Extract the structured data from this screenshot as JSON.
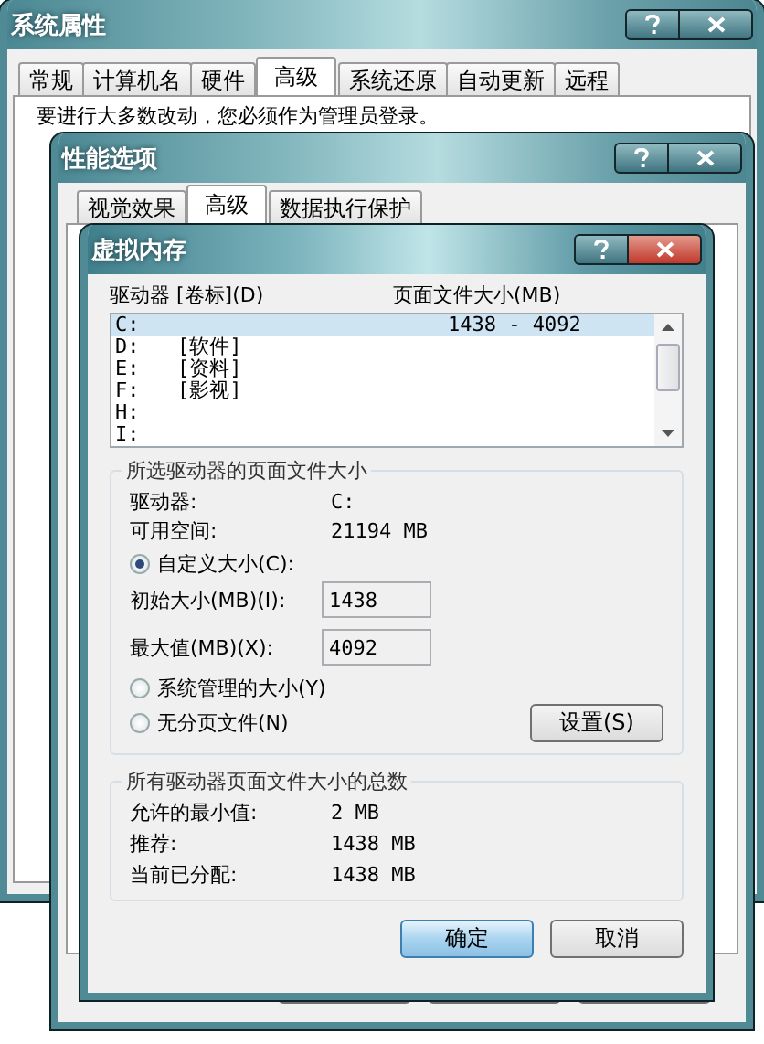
{
  "system_properties": {
    "title": "系统属性",
    "active": false,
    "tabs": [
      {
        "label": "常规",
        "selected": false
      },
      {
        "label": "计算机名",
        "selected": false
      },
      {
        "label": "硬件",
        "selected": false
      },
      {
        "label": "高级",
        "selected": true
      },
      {
        "label": "系统还原",
        "selected": false
      },
      {
        "label": "自动更新",
        "selected": false
      },
      {
        "label": "远程",
        "selected": false
      }
    ],
    "notice": "要进行大多数改动，您必须作为管理员登录。"
  },
  "performance_options": {
    "title": "性能选项",
    "active": false,
    "tabs": [
      {
        "label": "视觉效果",
        "selected": false
      },
      {
        "label": "高级",
        "selected": true
      },
      {
        "label": "数据执行保护",
        "selected": false
      }
    ]
  },
  "virtual_memory": {
    "title": "虚拟内存",
    "active": true,
    "columns": [
      "驱动器 [卷标](D)",
      "页面文件大小(MB)"
    ],
    "drives": [
      {
        "drive": "C:",
        "size": "1438 - 4092",
        "selected": true
      },
      {
        "drive": "D:",
        "label": "[软件]",
        "selected": false
      },
      {
        "drive": "E:",
        "label": "[资料]",
        "selected": false
      },
      {
        "drive": "F:",
        "label": "[影视]",
        "selected": false
      },
      {
        "drive": "H:",
        "selected": false
      },
      {
        "drive": "I:",
        "selected": false
      }
    ],
    "selected_drive": {
      "title": "所选驱动器的页面文件大小",
      "info": [
        {
          "label": "驱动器:",
          "value": "C:"
        },
        {
          "label": "可用空间:",
          "value": "21194 MB"
        }
      ],
      "options": [
        {
          "label": "自定义大小(C):",
          "selected": true
        },
        {
          "label": "系统管理的大小(Y)",
          "selected": false
        },
        {
          "label": "无分页文件(N)",
          "selected": false
        }
      ],
      "sizes": [
        {
          "label": "初始大小(MB)(I):",
          "value": "1438"
        },
        {
          "label": "最大值(MB)(X):",
          "value": "4092"
        }
      ],
      "set_button": "设置(S)"
    },
    "totals": {
      "title": "所有驱动器页面文件大小的总数",
      "rows": [
        {
          "label": "允许的最小值:",
          "value": "2 MB"
        },
        {
          "label": "推荐:",
          "value": "1438 MB"
        },
        {
          "label": "当前已分配:",
          "value": "1438 MB"
        }
      ]
    },
    "buttons": [
      {
        "label": "确定",
        "default": true
      },
      {
        "label": "取消",
        "default": false
      }
    ]
  }
}
